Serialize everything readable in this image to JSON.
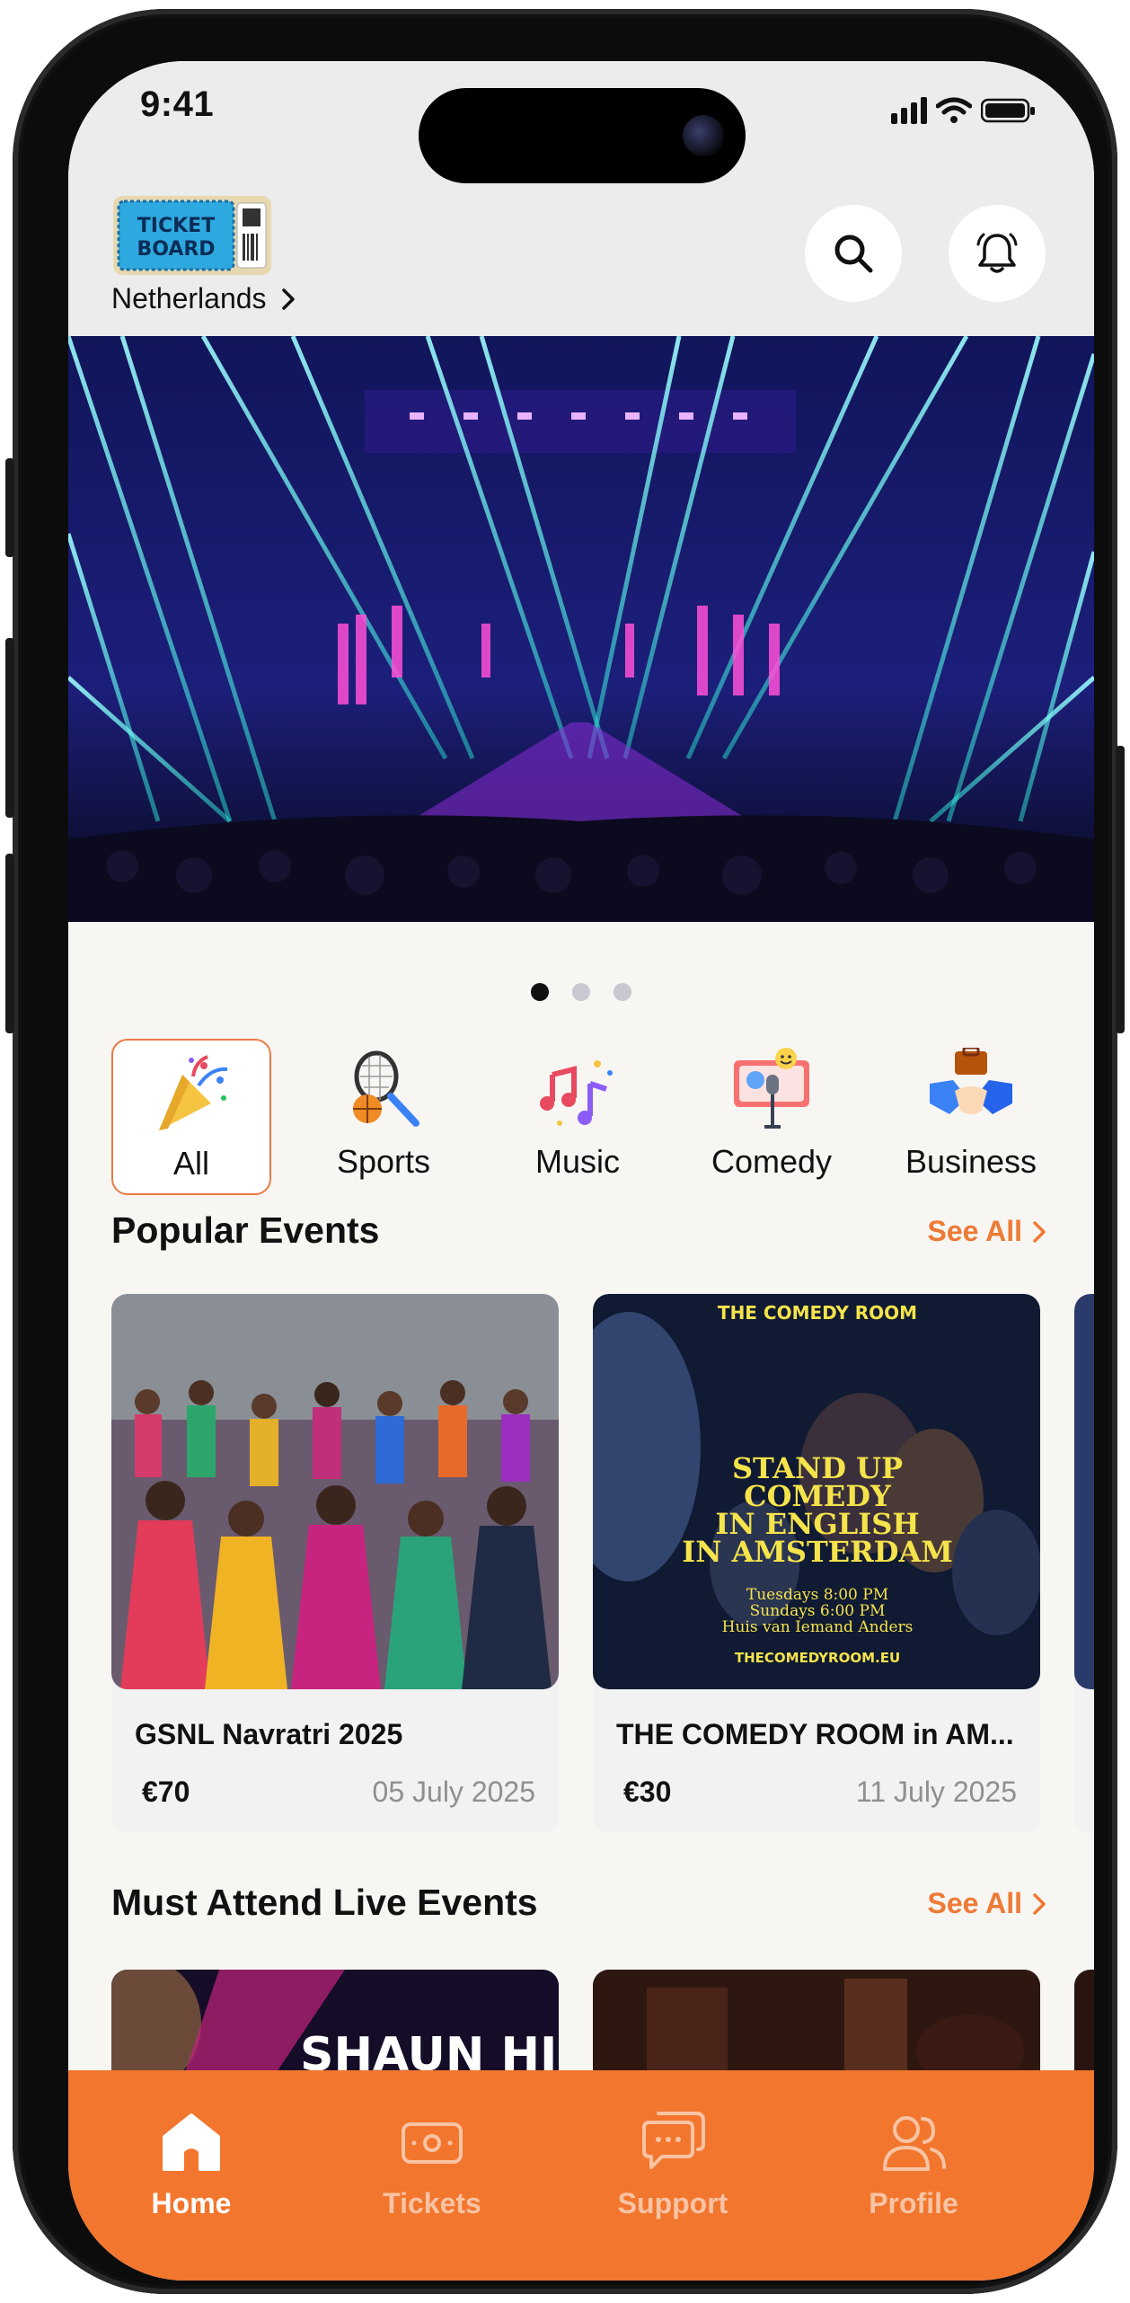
{
  "status_bar": {
    "time": "9:41"
  },
  "header": {
    "logo_text_line1": "TICKET",
    "logo_text_line2": "BOARD",
    "country": "Netherlands",
    "search_icon": "search-icon",
    "notification_icon": "bell-icon"
  },
  "carousel": {
    "pages": 3,
    "active_index": 0
  },
  "categories": [
    {
      "label": "All",
      "icon": "party-popper-icon",
      "active": true
    },
    {
      "label": "Sports",
      "icon": "racket-ball-icon",
      "active": false
    },
    {
      "label": "Music",
      "icon": "music-notes-icon",
      "active": false
    },
    {
      "label": "Comedy",
      "icon": "comedy-mic-icon",
      "active": false
    },
    {
      "label": "Business",
      "icon": "handshake-icon",
      "active": false
    }
  ],
  "popular": {
    "title": "Popular Events",
    "see_all": "See All",
    "events": [
      {
        "title": "GSNL Navratri 2025",
        "price": "€70",
        "date": "05 July 2025"
      },
      {
        "title": "THE COMEDY ROOM in AM...",
        "price": "€30",
        "date": "11 July 2025",
        "poster": {
          "header": "THE COMEDY ROOM",
          "line1": "STAND UP",
          "line2": "COMEDY",
          "line3": "IN ENGLISH",
          "line4": "IN AMSTERDAM",
          "sched1": "Tuesdays 8:00 PM",
          "sched2": "Sundays 6:00 PM",
          "sched3": "Huis van Iemand Anders",
          "site": "THECOMEDYROOM.EU"
        }
      }
    ]
  },
  "live": {
    "title": "Must Attend Live Events",
    "see_all": "See All",
    "first_card_text": "SHAUN HI"
  },
  "tabbar": {
    "items": [
      {
        "label": "Home",
        "icon": "home-icon",
        "active": true
      },
      {
        "label": "Tickets",
        "icon": "ticket-icon",
        "active": false
      },
      {
        "label": "Support",
        "icon": "chat-bubbles-icon",
        "active": false
      },
      {
        "label": "Profile",
        "icon": "users-icon",
        "active": false
      }
    ]
  },
  "colors": {
    "accent": "#F2762D",
    "active_border": "#EA7A44",
    "see_all": "#EE7A35"
  }
}
